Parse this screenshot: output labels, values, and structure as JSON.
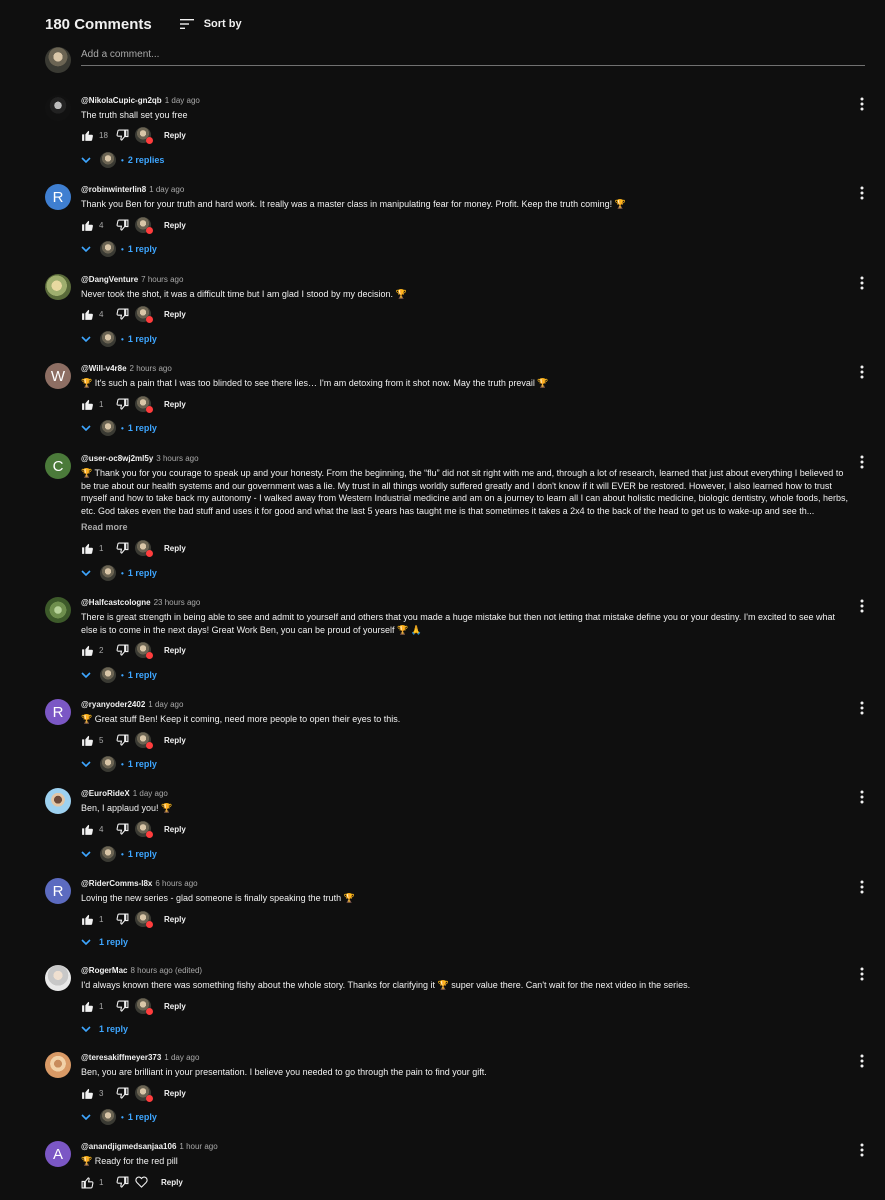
{
  "header": {
    "count": "180 Comments",
    "sort_label": "Sort by"
  },
  "add_comment": {
    "placeholder": "Add a comment..."
  },
  "reply_label": "Reply",
  "read_more": "Read more",
  "comments": [
    {
      "author": "@NikolaCupic-gn2qb",
      "time": "1 day ago",
      "text": "The truth shall set you free",
      "likes": "18",
      "replies": "2 replies"
    },
    {
      "author": "@robinwinterlin8",
      "time": "1 day ago",
      "letter": "R",
      "text": "Thank you Ben for your truth and hard work. It really was a master class in manipulating fear for money. Profit. Keep the truth coming! 🏆",
      "likes": "4",
      "replies": "1 reply"
    },
    {
      "author": "@DangVenture",
      "time": "7 hours ago",
      "text": "Never took the shot, it was a difficult time but I am glad I stood by my decision. 🏆",
      "likes": "4",
      "replies": "1 reply"
    },
    {
      "author": "@Will-v4r8e",
      "time": "2 hours ago",
      "letter": "W",
      "text": "🏆 It's such a pain that I was too blinded to see there lies… I'm am detoxing from it shot now. May the truth prevail 🏆",
      "likes": "1",
      "replies": "1 reply"
    },
    {
      "author": "@user-oc8wj2ml5y",
      "time": "3 hours ago",
      "letter": "C",
      "text": "🏆 Thank you for you courage to speak up and your honesty.  From the beginning, the “flu” did not sit right with me and, through a lot of research, learned that just about everything I believed to be true about our health systems and our government was a lie.  My trust in all things worldly suffered greatly and I don't know if it will EVER be restored.  However, I also learned how to trust myself and how to take back my autonomy - I walked away from Western Industrial medicine and am on a journey to learn all I can about holistic medicine, biologic dentistry, whole foods, herbs, etc.  God takes even the bad stuff and uses it for good and what the last 5 years has taught me is that sometimes it takes a 2x4 to the back of the head to get us to wake-up and see th...",
      "likes": "1",
      "replies": "1 reply"
    },
    {
      "author": "@Halfcastcologne",
      "time": "23 hours ago",
      "text": "There is great strength in being able to see and admit to yourself and others that you made a huge mistake but then not letting that mistake define you or your destiny. I'm excited to see what else is to come in the next days! Great Work Ben, you can be proud of yourself 🏆 🙏",
      "likes": "2",
      "replies": "1 reply"
    },
    {
      "author": "@ryanyoder2402",
      "time": "1 day ago",
      "letter": "R",
      "text": "🏆 Great stuff Ben! Keep it coming, need more people to open their eyes to this.",
      "likes": "5",
      "replies": "1 reply"
    },
    {
      "author": "@EuroRideX",
      "time": "1 day ago",
      "text": "Ben, I applaud you! 🏆",
      "likes": "4",
      "replies": "1 reply"
    },
    {
      "author": "@RiderComms-l8x",
      "time": "6 hours ago",
      "letter": "R",
      "text": "Loving the new series - glad someone is finally speaking the truth  🏆",
      "likes": "1",
      "replies": "1 reply"
    },
    {
      "author": "@RogerMac",
      "time": "8 hours ago (edited)",
      "text": "I'd always known there was something fishy about the whole story. Thanks for clarifying it 🏆 super value there. Can't wait for the next video in the series.",
      "likes": "1",
      "replies": "1 reply"
    },
    {
      "author": "@teresakiffmeyer373",
      "time": "1 day ago",
      "text": "Ben, you are brilliant in your presentation.  I believe you needed to go through the pain to find your gift.",
      "likes": "3",
      "replies": "1 reply"
    },
    {
      "author": "@anandjigmedsanjaa106",
      "time": "1 hour ago",
      "letter": "A",
      "text": "🏆 Ready for the red pill",
      "likes": "1"
    }
  ]
}
